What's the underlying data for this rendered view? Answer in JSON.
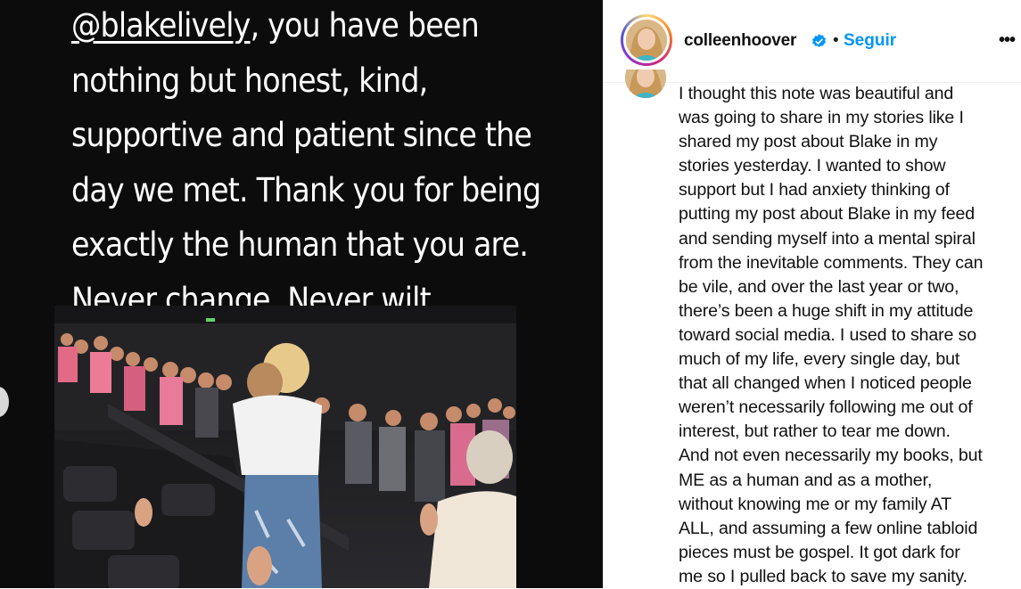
{
  "media": {
    "quote_mention": "@blakelively",
    "quote_lines": [
      ", you have been",
      "nothing but honest, kind,",
      "supportive and patient since the",
      "day we met. Thank you for being",
      "exactly the human that you are.",
      "Never change. Never wilt."
    ]
  },
  "post": {
    "username": "colleenhoover",
    "separator": "•",
    "follow_label": "Seguir",
    "more_label": "•••",
    "caption_lines": [
      "I thought this note was beautiful and",
      "was going to share in my stories like I",
      "shared my post about Blake in my",
      "stories yesterday. I wanted to show",
      "support but I had anxiety thinking of",
      "putting my post about Blake in my feed",
      "and sending myself into a mental spiral",
      "from the inevitable comments. They can",
      "be vile, and over the last year or two,",
      "there’s been a huge shift in my attitude",
      "toward social media. I used to share so",
      "much of my life, every single day, but",
      "that all changed when I noticed people",
      "weren’t necessarily following me out of",
      "interest, but rather to tear me down.",
      "And not even necessarily my books, but",
      "ME as a human and as a mother,",
      "without knowing me or my family AT",
      "ALL, and assuming a few online tabloid",
      "pieces must be gospel. It got dark for",
      "me so I pulled back to save my sanity."
    ]
  },
  "colors": {
    "accent": "#0095f6",
    "verified": "#0095f6",
    "media_bg": "#0c0c0c"
  },
  "icons": {
    "verified": "verified-badge-icon",
    "more": "more-options-icon",
    "carousel_prev": "carousel-prev-icon"
  }
}
